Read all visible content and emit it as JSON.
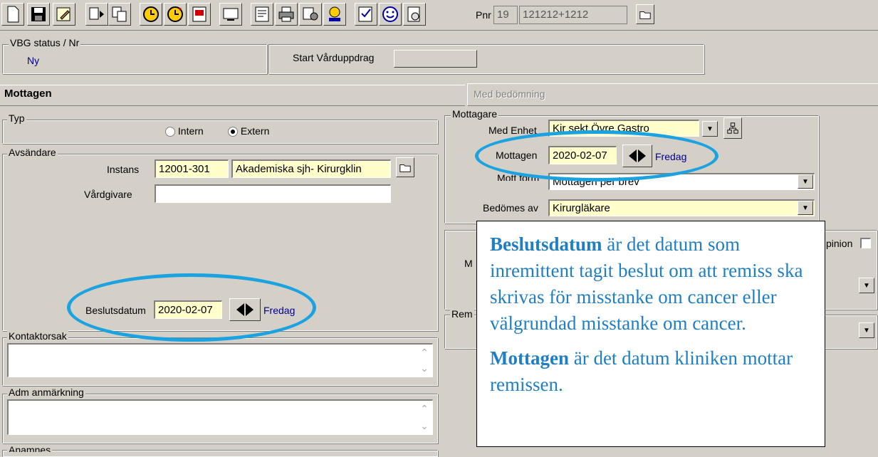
{
  "toolbar": {
    "buttons": [
      "new-doc-icon",
      "save-icon",
      "edit-icon",
      "forward-icon",
      "copy-icon",
      "clock-icon",
      "clock-refresh-icon",
      "print-preview-icon",
      "monitor-icon",
      "notes-icon",
      "printer-icon",
      "stamp-icon",
      "robot-icon",
      "checklist-icon",
      "smiley-icon",
      "doc-person-icon"
    ],
    "pnr_label": "Pnr",
    "pnr_century": "19",
    "pnr_value": "121212+1212"
  },
  "vbg": {
    "legend": "VBG status / Nr",
    "status": "Ny",
    "start_label": "Start Vårduppdrag",
    "start_value": ""
  },
  "headers": {
    "left": "Mottagen",
    "right": "Med bedömning"
  },
  "typ": {
    "legend": "Typ",
    "option_intern": "Intern",
    "option_extern": "Extern",
    "selected": "Extern"
  },
  "avsandare": {
    "legend": "Avsändare",
    "instans_label": "Instans",
    "instans_code": "12001-301",
    "instans_name": "Akademiska sjh- Kirurgklin",
    "vardgivare_label": "Vårdgivare",
    "vardgivare_value": "",
    "beslutsdatum_label": "Beslutsdatum",
    "beslutsdatum_value": "2020-02-07",
    "beslutsdatum_day": "Fredag"
  },
  "kontaktorsak": {
    "legend": "Kontaktorsak",
    "value": ""
  },
  "adm": {
    "legend": "Adm anmärkning",
    "value": ""
  },
  "anamnes": {
    "legend": "Anamnes"
  },
  "mottagare": {
    "legend": "Mottagare",
    "med_enhet_label": "Med Enhet",
    "med_enhet_value": "Kir sekt Övre Gastro",
    "mottagen_label": "Mottagen",
    "mottagen_value": "2020-02-07",
    "mottagen_day": "Fredag",
    "mott_form_label": "Mott form",
    "mott_form_value": "Mottagen per brev",
    "bedomes_label": "Bedömes av",
    "bedomes_value": "Kirurgläkare"
  },
  "partial": {
    "opinion_label": "pinion",
    "m_label": "M",
    "rem_label": "Rem"
  },
  "callout": {
    "p1_bold": "Beslutsdatum",
    "p1_rest": " är det datum som inremittent tagit beslut om att remiss ska skrivas för misstanke om cancer eller välgrundad misstanke om cancer.",
    "p2_bold": "Mottagen",
    "p2_rest": " är det datum kliniken mottar remissen."
  },
  "colors": {
    "highlight_ellipse": "#1aa3e0",
    "callout_text": "#1f7ec4",
    "field_yellow": "#ffffcc",
    "date_day": "#00008b"
  }
}
